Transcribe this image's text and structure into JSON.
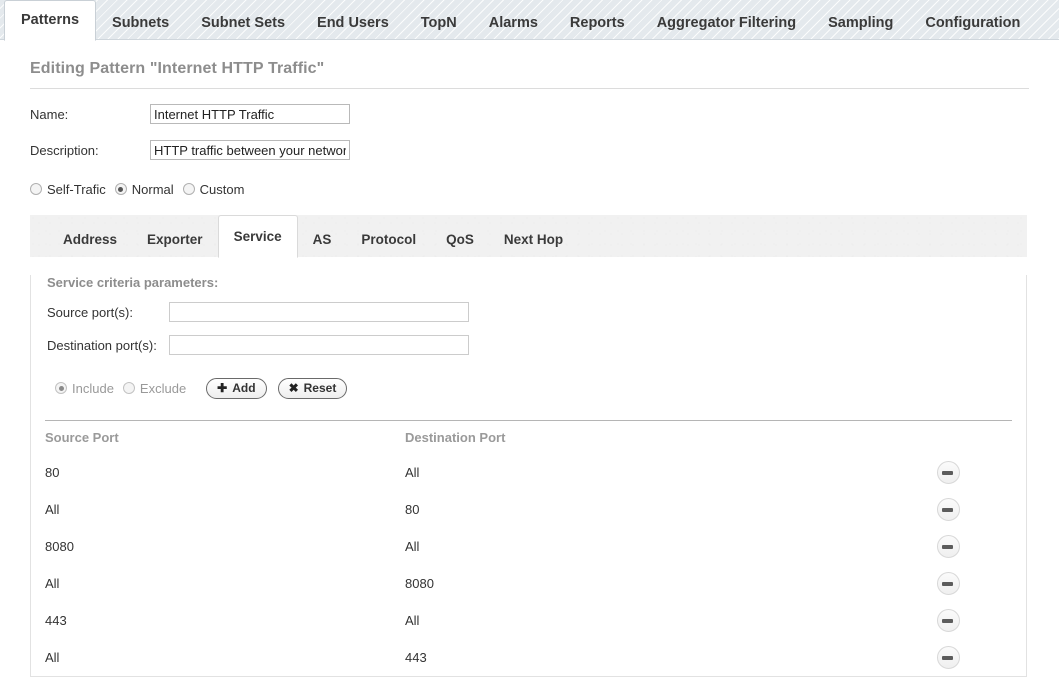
{
  "top_nav": {
    "tabs": [
      {
        "label": "Patterns",
        "active": true
      },
      {
        "label": "Subnets",
        "active": false
      },
      {
        "label": "Subnet Sets",
        "active": false
      },
      {
        "label": "End Users",
        "active": false
      },
      {
        "label": "TopN",
        "active": false
      },
      {
        "label": "Alarms",
        "active": false
      },
      {
        "label": "Reports",
        "active": false
      },
      {
        "label": "Aggregator Filtering",
        "active": false
      },
      {
        "label": "Sampling",
        "active": false
      },
      {
        "label": "Configuration",
        "active": false
      }
    ]
  },
  "page": {
    "title": "Editing Pattern \"Internet HTTP Traffic\""
  },
  "form": {
    "name_label": "Name:",
    "name_value": "Internet HTTP Traffic",
    "name_placeholder": "",
    "description_label": "Description:",
    "description_value": "HTTP traffic between your network and the Internet",
    "description_placeholder": "",
    "mode_radios": [
      {
        "label": "Self-Trafic",
        "checked": false
      },
      {
        "label": "Normal",
        "checked": true
      },
      {
        "label": "Custom",
        "checked": false
      }
    ]
  },
  "inner_tabs": [
    {
      "label": "Address",
      "active": false
    },
    {
      "label": "Exporter",
      "active": false
    },
    {
      "label": "Service",
      "active": true
    },
    {
      "label": "AS",
      "active": false
    },
    {
      "label": "Protocol",
      "active": false
    },
    {
      "label": "QoS",
      "active": false
    },
    {
      "label": "Next Hop",
      "active": false
    }
  ],
  "service": {
    "criteria_title": "Service criteria parameters:",
    "source_port_label": "Source port(s):",
    "source_port_value": "",
    "source_port_placeholder": "",
    "destination_port_label": "Destination port(s):",
    "destination_port_value": "",
    "destination_port_placeholder": "",
    "filter_radios": [
      {
        "label": "Include",
        "checked": true
      },
      {
        "label": "Exclude",
        "checked": false
      }
    ],
    "add_button": "Add",
    "add_icon": "plus-icon",
    "reset_button": "Reset",
    "reset_icon": "cross-icon",
    "table": {
      "columns": [
        "Source Port",
        "Destination Port"
      ],
      "rows": [
        {
          "source": "80",
          "destination": "All",
          "remove_icon": "minus-circle-icon"
        },
        {
          "source": "All",
          "destination": "80",
          "remove_icon": "minus-circle-icon"
        },
        {
          "source": "8080",
          "destination": "All",
          "remove_icon": "minus-circle-icon"
        },
        {
          "source": "All",
          "destination": "8080",
          "remove_icon": "minus-circle-icon"
        },
        {
          "source": "443",
          "destination": "All",
          "remove_icon": "minus-circle-icon"
        },
        {
          "source": "All",
          "destination": "443",
          "remove_icon": "minus-circle-icon"
        }
      ]
    }
  },
  "colors": {
    "topbar_bg": "#e4e9ed",
    "panel_bg": "#f1f1f1",
    "muted_text": "#9a9a9a",
    "body_text": "#333333"
  }
}
